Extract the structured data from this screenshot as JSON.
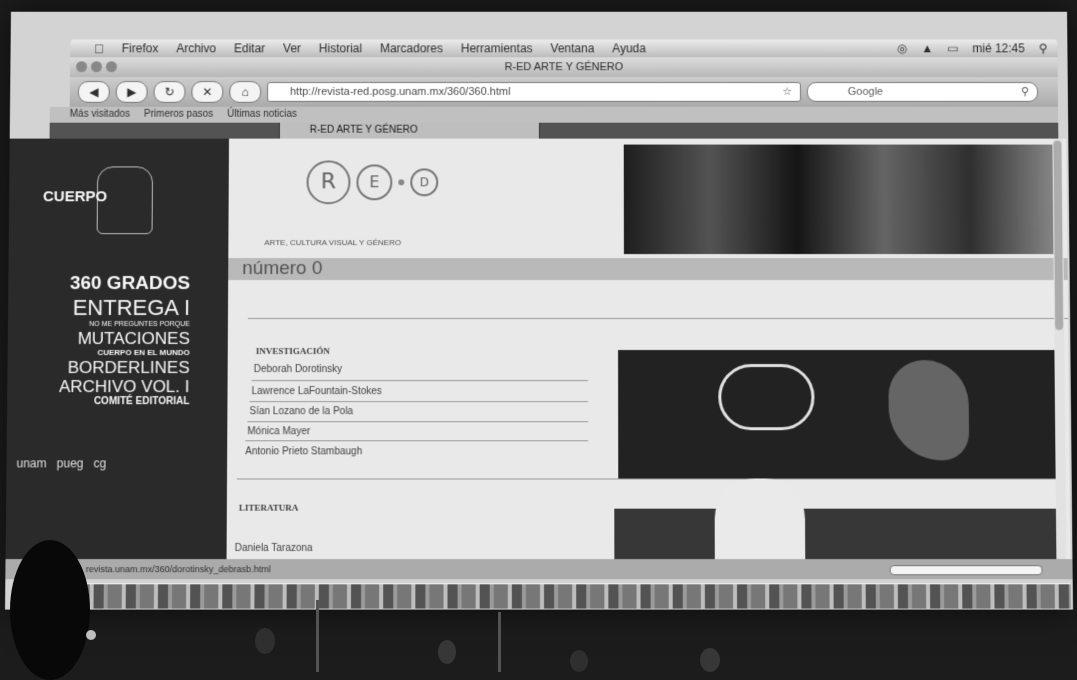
{
  "menubar": {
    "apple": "",
    "items": [
      "Firefox",
      "Archivo",
      "Editar",
      "Ver",
      "Historial",
      "Marcadores",
      "Herramientas",
      "Ventana",
      "Ayuda"
    ],
    "clock": "mié 12:45"
  },
  "window": {
    "title": "R-ED ARTE Y GÉNERO"
  },
  "toolbar": {
    "url": "http://revista-red.posg.unam.mx/360/360.html",
    "search_placeholder": "Google"
  },
  "bookmarks": [
    "Más visitados",
    "Primeros pasos",
    "Últimas noticias"
  ],
  "tabs": [
    {
      "label": ""
    },
    {
      "label": "R-ED ARTE Y GÉNERO"
    }
  ],
  "sidebar": {
    "cuerpo": "CUERPO",
    "menu": {
      "grados": "360 GRADOS",
      "entrega": "ENTREGA I",
      "tiny": "NO ME PREGUNTES PORQUE",
      "mutaciones": "MUTACIONES",
      "cuerpo_mundo": "CUERPO EN EL MUNDO",
      "borderlines": "BORDERLINES",
      "archivo": "ARCHIVO VOL. I",
      "comite": "COMITÉ EDITORIAL"
    },
    "logos": [
      "unam",
      "pueg",
      "cg"
    ]
  },
  "main": {
    "logo": {
      "r": "R",
      "e": "E",
      "d": "D"
    },
    "tagline": "ARTE, CULTURA VISUAL Y GÉNERO",
    "numero": "número 0",
    "investigacion": {
      "title": "INVESTIGACIÓN",
      "authors": [
        "Deborah Dorotinsky",
        "Lawrence LaFountain-Stokes",
        "Sían Lozano de la Pola",
        "Mónica Mayer",
        "Antonio Prieto Stambaugh"
      ]
    },
    "literatura": {
      "title": "LITERATURA",
      "authors": [
        "Daniela Tarazona"
      ]
    }
  },
  "statusbar": {
    "text": "revista.unam.mx/360/dorotinsky_debrasb.html"
  }
}
